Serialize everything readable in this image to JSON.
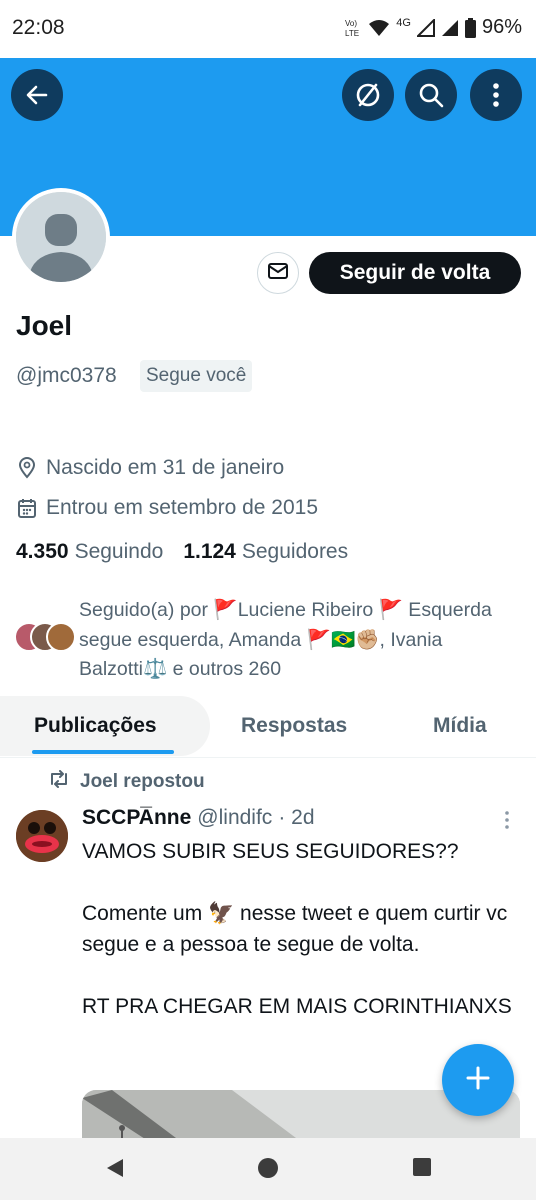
{
  "status_bar": {
    "time": "22:08",
    "network_label": "Vo) LTE",
    "network_type": "4G",
    "battery": "96%"
  },
  "header": {
    "banner_color": "#1d9bf0",
    "back_icon": "arrow-left-icon",
    "hide_icon": "eye-slash-icon",
    "search_icon": "search-icon",
    "more_icon": "more-vertical-icon"
  },
  "profile": {
    "name": "Joel",
    "handle": "@jmc0378",
    "follows_you_badge": "Segue você",
    "birthday": "Nascido em 31 de janeiro",
    "joined": "Entrou em setembro de 2015",
    "following_count": "4.350",
    "following_label": "Seguindo",
    "followers_count": "1.124",
    "followers_label": "Seguidores",
    "followed_by": "Seguido(a) por 🚩Luciene Ribeiro 🚩 Esquerda segue esquerda, Amanda 🚩🇧🇷✊🏼, Ivania Balzotti⚖️ e outros 260"
  },
  "actions": {
    "message_icon": "mail-icon",
    "follow_back_label": "Seguir de volta"
  },
  "tabs": [
    {
      "label": "Publicações",
      "active": true
    },
    {
      "label": "Respostas",
      "active": false
    },
    {
      "label": "Mídia",
      "active": false
    }
  ],
  "post": {
    "repost_label": "Joel repostou",
    "author": "SCCPA̅nne",
    "handle": "@lindifc",
    "time": "· 2d",
    "text": "VAMOS SUBIR SEUS SEGUIDORES??\n\nComente um 🦅 nesse tweet e quem curtir vc segue e a pessoa te segue de volta.\n\nRT PRA CHEGAR EM MAIS CORINTHIANXS"
  },
  "fab": {
    "icon": "plus-icon"
  },
  "nav": {
    "back": "back-triangle-icon",
    "home": "home-circle-icon",
    "recents": "recents-square-icon"
  }
}
